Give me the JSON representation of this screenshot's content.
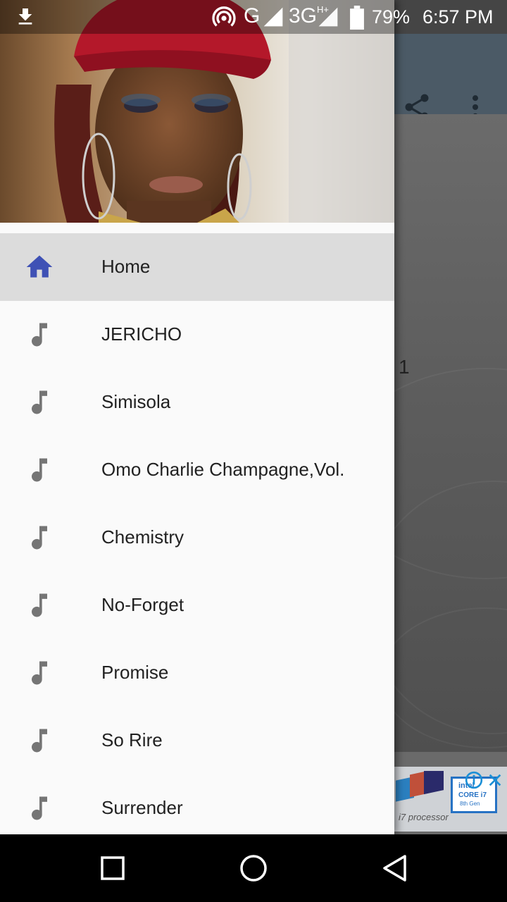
{
  "status_bar": {
    "icons": [
      "download-icon",
      "hotspot-icon",
      "signal-icon",
      "signal-3g-icon",
      "battery-icon"
    ],
    "network_g": "G",
    "network_3g": "3G",
    "network_3g_sup": "H+",
    "battery_percent": "79%",
    "time": "6:57 PM"
  },
  "toolbar": {
    "icons": [
      "share-icon",
      "more-vert-icon"
    ]
  },
  "content": {
    "page_count": "1"
  },
  "ad": {
    "tagline": "i7 processor",
    "chip_brand": "intel",
    "chip_model": "CORE i7",
    "chip_gen": "8th Gen"
  },
  "drawer": {
    "items": [
      {
        "label": "Home",
        "icon": "home-icon",
        "active": true
      },
      {
        "label": "JERICHO",
        "icon": "music-note-icon"
      },
      {
        "label": "Simisola",
        "icon": "music-note-icon"
      },
      {
        "label": "Omo Charlie Champagne,Vol.",
        "icon": "music-note-icon"
      },
      {
        "label": "Chemistry",
        "icon": "music-note-icon"
      },
      {
        "label": "No-Forget",
        "icon": "music-note-icon"
      },
      {
        "label": "Promise",
        "icon": "music-note-icon"
      },
      {
        "label": "So Rire",
        "icon": "music-note-icon"
      },
      {
        "label": "Surrender",
        "icon": "music-note-icon"
      }
    ]
  },
  "colors": {
    "accent": "#3f51b5",
    "drawer_bg": "#fafafa",
    "active_item_bg": "#dcdcdc",
    "icon_gray": "#757575",
    "toolbar_dim": "#4b5a66"
  }
}
